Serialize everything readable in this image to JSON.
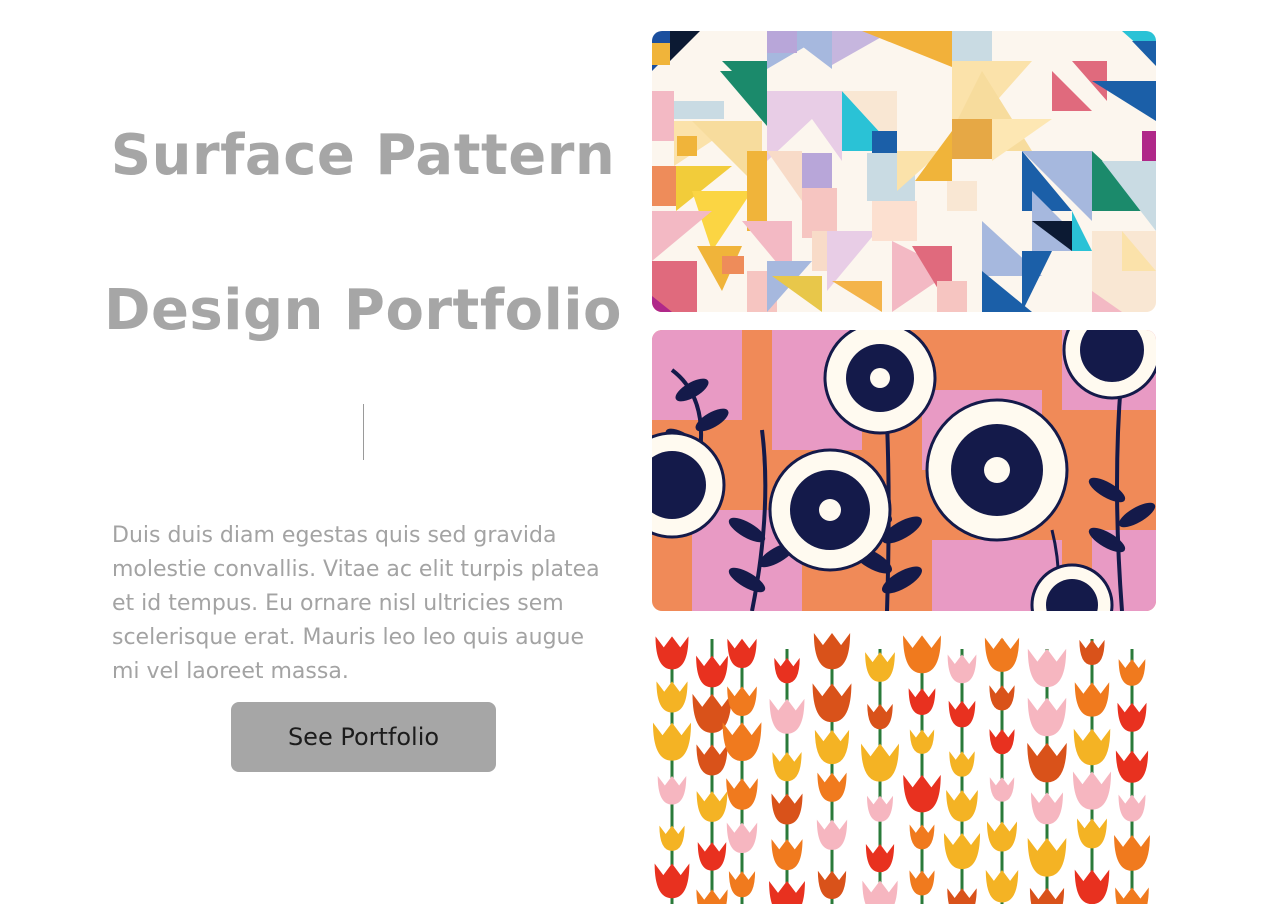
{
  "hero": {
    "title_line_1": "Surface Pattern",
    "title_line_2": "Design Portfolio",
    "description": "Duis duis diam egestas quis sed gravida molestie convallis. Vitae ac elit turpis platea et id tempus. Eu ornare nisl ultricies sem scelerisque erat. Mauris leo leo quis augue mi vel laoreet massa.",
    "cta_label": "See Portfolio"
  },
  "gallery": {
    "items": [
      {
        "pattern": "geometric-triangles"
      },
      {
        "pattern": "navy-floral-on-pink-orange"
      },
      {
        "pattern": "tulip-field"
      }
    ]
  },
  "colors": {
    "title_gray": "#a6a6a6",
    "text_gray": "#a3a3a3",
    "button_bg": "#a6a6a6",
    "button_text": "#1c1c1c"
  }
}
